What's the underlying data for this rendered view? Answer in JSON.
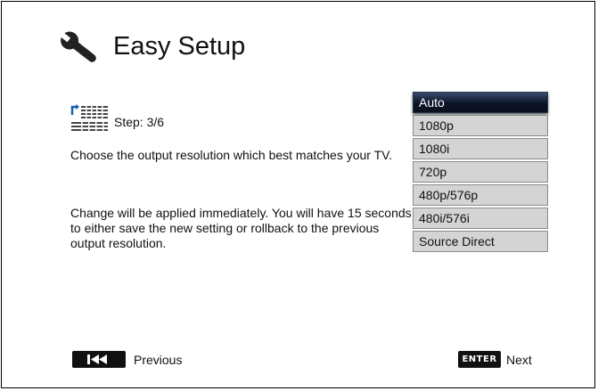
{
  "header": {
    "title": "Easy Setup",
    "icon": "wrench-icon"
  },
  "step": {
    "label": "Step: 3/6",
    "icon": "grid-step-icon"
  },
  "description": {
    "line1": "Choose the output resolution which best matches your TV.",
    "line2": "Change will be applied immediately.  You will have 15 seconds to either save the new setting or rollback to the previous output resolution."
  },
  "options": [
    {
      "label": "Auto",
      "selected": true
    },
    {
      "label": "1080p",
      "selected": false
    },
    {
      "label": "1080i",
      "selected": false
    },
    {
      "label": "720p",
      "selected": false
    },
    {
      "label": "480p/576p",
      "selected": false
    },
    {
      "label": "480i/576i",
      "selected": false
    },
    {
      "label": "Source Direct",
      "selected": false
    }
  ],
  "footer": {
    "previous_label": "Previous",
    "previous_icon": "skip-back-icon",
    "enter_key": "ENTER",
    "next_label": "Next"
  },
  "colors": {
    "selected_bg": "#0b1426",
    "option_bg": "#d4d4d4",
    "icon_blue": "#1a5fb4"
  }
}
